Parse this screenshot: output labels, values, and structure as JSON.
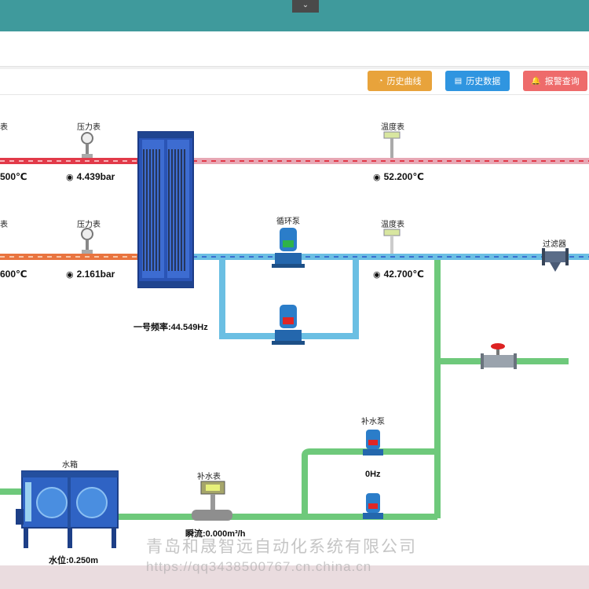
{
  "toolbar": {
    "history_curve": "历史曲线",
    "history_data": "历史数据",
    "alarm_query": "报警查询"
  },
  "colors": {
    "topbar": "#3f9a9c",
    "btn_curve": "#e8a33b",
    "btn_data": "#2f95e0",
    "btn_alarm": "#ee6b6b",
    "hot_pipe": "#e23a49",
    "cold_pipe": "#e9743f",
    "blue_pipe": "#6bbfe3",
    "green_pipe": "#6ec97b"
  },
  "instruments": {
    "left_temp_1_label": "表",
    "left_temp_1_value": "500℃",
    "pressure_1_label": "压力表",
    "pressure_1_value": "4.439bar",
    "temp_1_label": "温度表",
    "temp_1_value": "52.200℃",
    "left_temp_2_label": "表",
    "left_temp_2_value": "600℃",
    "pressure_2_label": "压力表",
    "pressure_2_value": "2.161bar",
    "circ_pump_label": "循环泵",
    "temp_2_label": "温度表",
    "temp_2_value": "42.700℃",
    "filter_label": "过滤器",
    "freq_label": "一号频率:44.549Hz",
    "makeup_pump_label": "补水泵",
    "makeup_pump_freq": "0Hz",
    "tank_label": "水箱",
    "tank_level": "水位:0.250m",
    "makeup_meter_label": "补水表",
    "flow_value": "瞬流:0.000m³/h"
  },
  "watermark": {
    "company": "青岛和晟智远自动化系统有限公司",
    "url": "https://qq3438500767.cn.china.cn"
  }
}
